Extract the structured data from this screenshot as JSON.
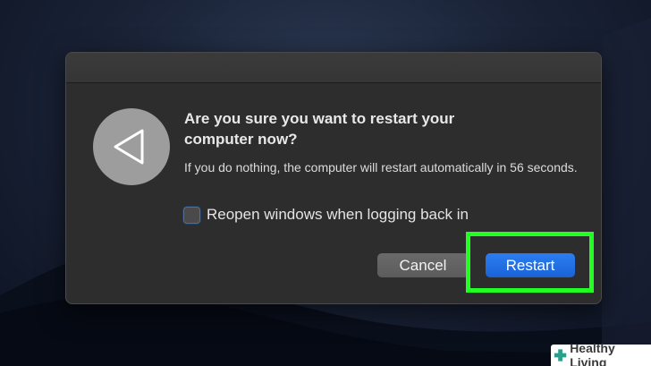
{
  "dialog": {
    "title": "Are you sure you want to restart your computer now?",
    "message": "If you do nothing, the computer will restart automatically in 56 seconds.",
    "checkbox": {
      "label": "Reopen windows when logging back in",
      "checked": false
    },
    "buttons": {
      "cancel_label": "Cancel",
      "restart_label": "Restart"
    },
    "icon": "restart-triangle-icon"
  },
  "highlight_color": "#22ff22",
  "watermark": {
    "text": "Healthy Living"
  }
}
